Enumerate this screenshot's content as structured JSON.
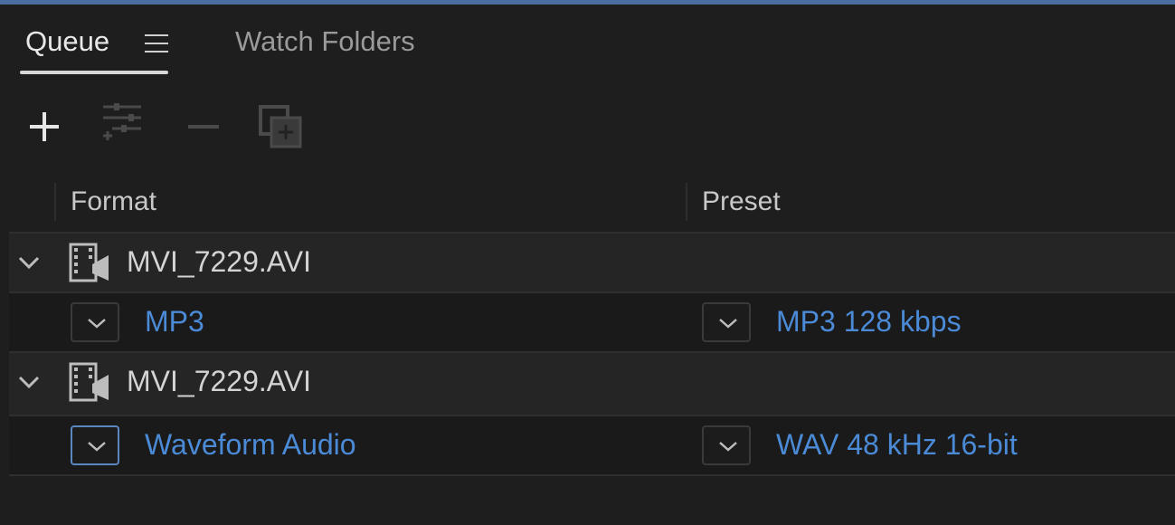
{
  "tabs": {
    "queue": "Queue",
    "watch_folders": "Watch Folders"
  },
  "toolbar": {
    "icons": [
      "plus-icon",
      "settings-sliders-icon",
      "minus-icon",
      "duplicate-icon"
    ]
  },
  "columns": {
    "format": "Format",
    "preset": "Preset"
  },
  "queue": [
    {
      "source": "MVI_7229.AVI",
      "format": "MP3",
      "preset": "MP3 128 kbps"
    },
    {
      "source": "MVI_7229.AVI",
      "format": "Waveform Audio",
      "preset": "WAV 48 kHz 16-bit"
    }
  ],
  "colors": {
    "accent_blue": "#4b8ad6",
    "top_line": "#4a6fa0",
    "background": "#1e1e1e"
  }
}
